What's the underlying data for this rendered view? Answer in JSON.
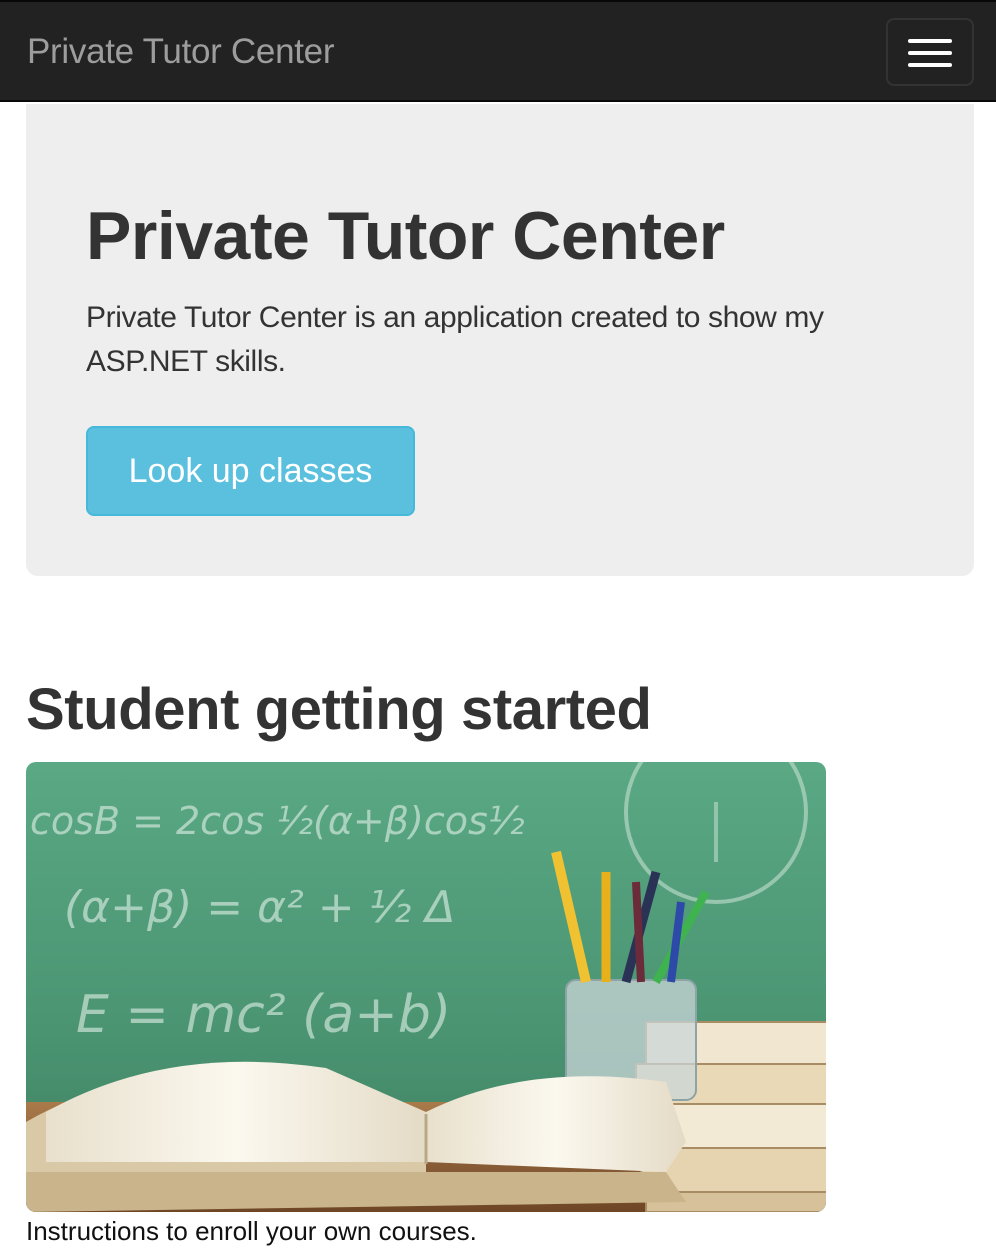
{
  "navbar": {
    "brand": "Private Tutor Center",
    "toggle_icon": "hamburger-menu-icon"
  },
  "jumbotron": {
    "title": "Private Tutor Center",
    "lead": "Private Tutor Center is an application created to show my ASP.NET skills.",
    "button_label": "Look up classes"
  },
  "student_section": {
    "heading": "Student getting started",
    "image_chalk": {
      "line1": "cosB = 2cos ½(α+β)cos½",
      "line2": "(α+β) = α² + ½ Δ",
      "line3": "E = mc²  (a+b)"
    },
    "caption": "Instructions to enroll your own courses."
  },
  "colors": {
    "navbar_bg": "#222222",
    "brand_text": "#9d9d9d",
    "jumbotron_bg": "#eeeeee",
    "button_bg": "#5bc0de",
    "chalkboard": "#4e9a76"
  }
}
